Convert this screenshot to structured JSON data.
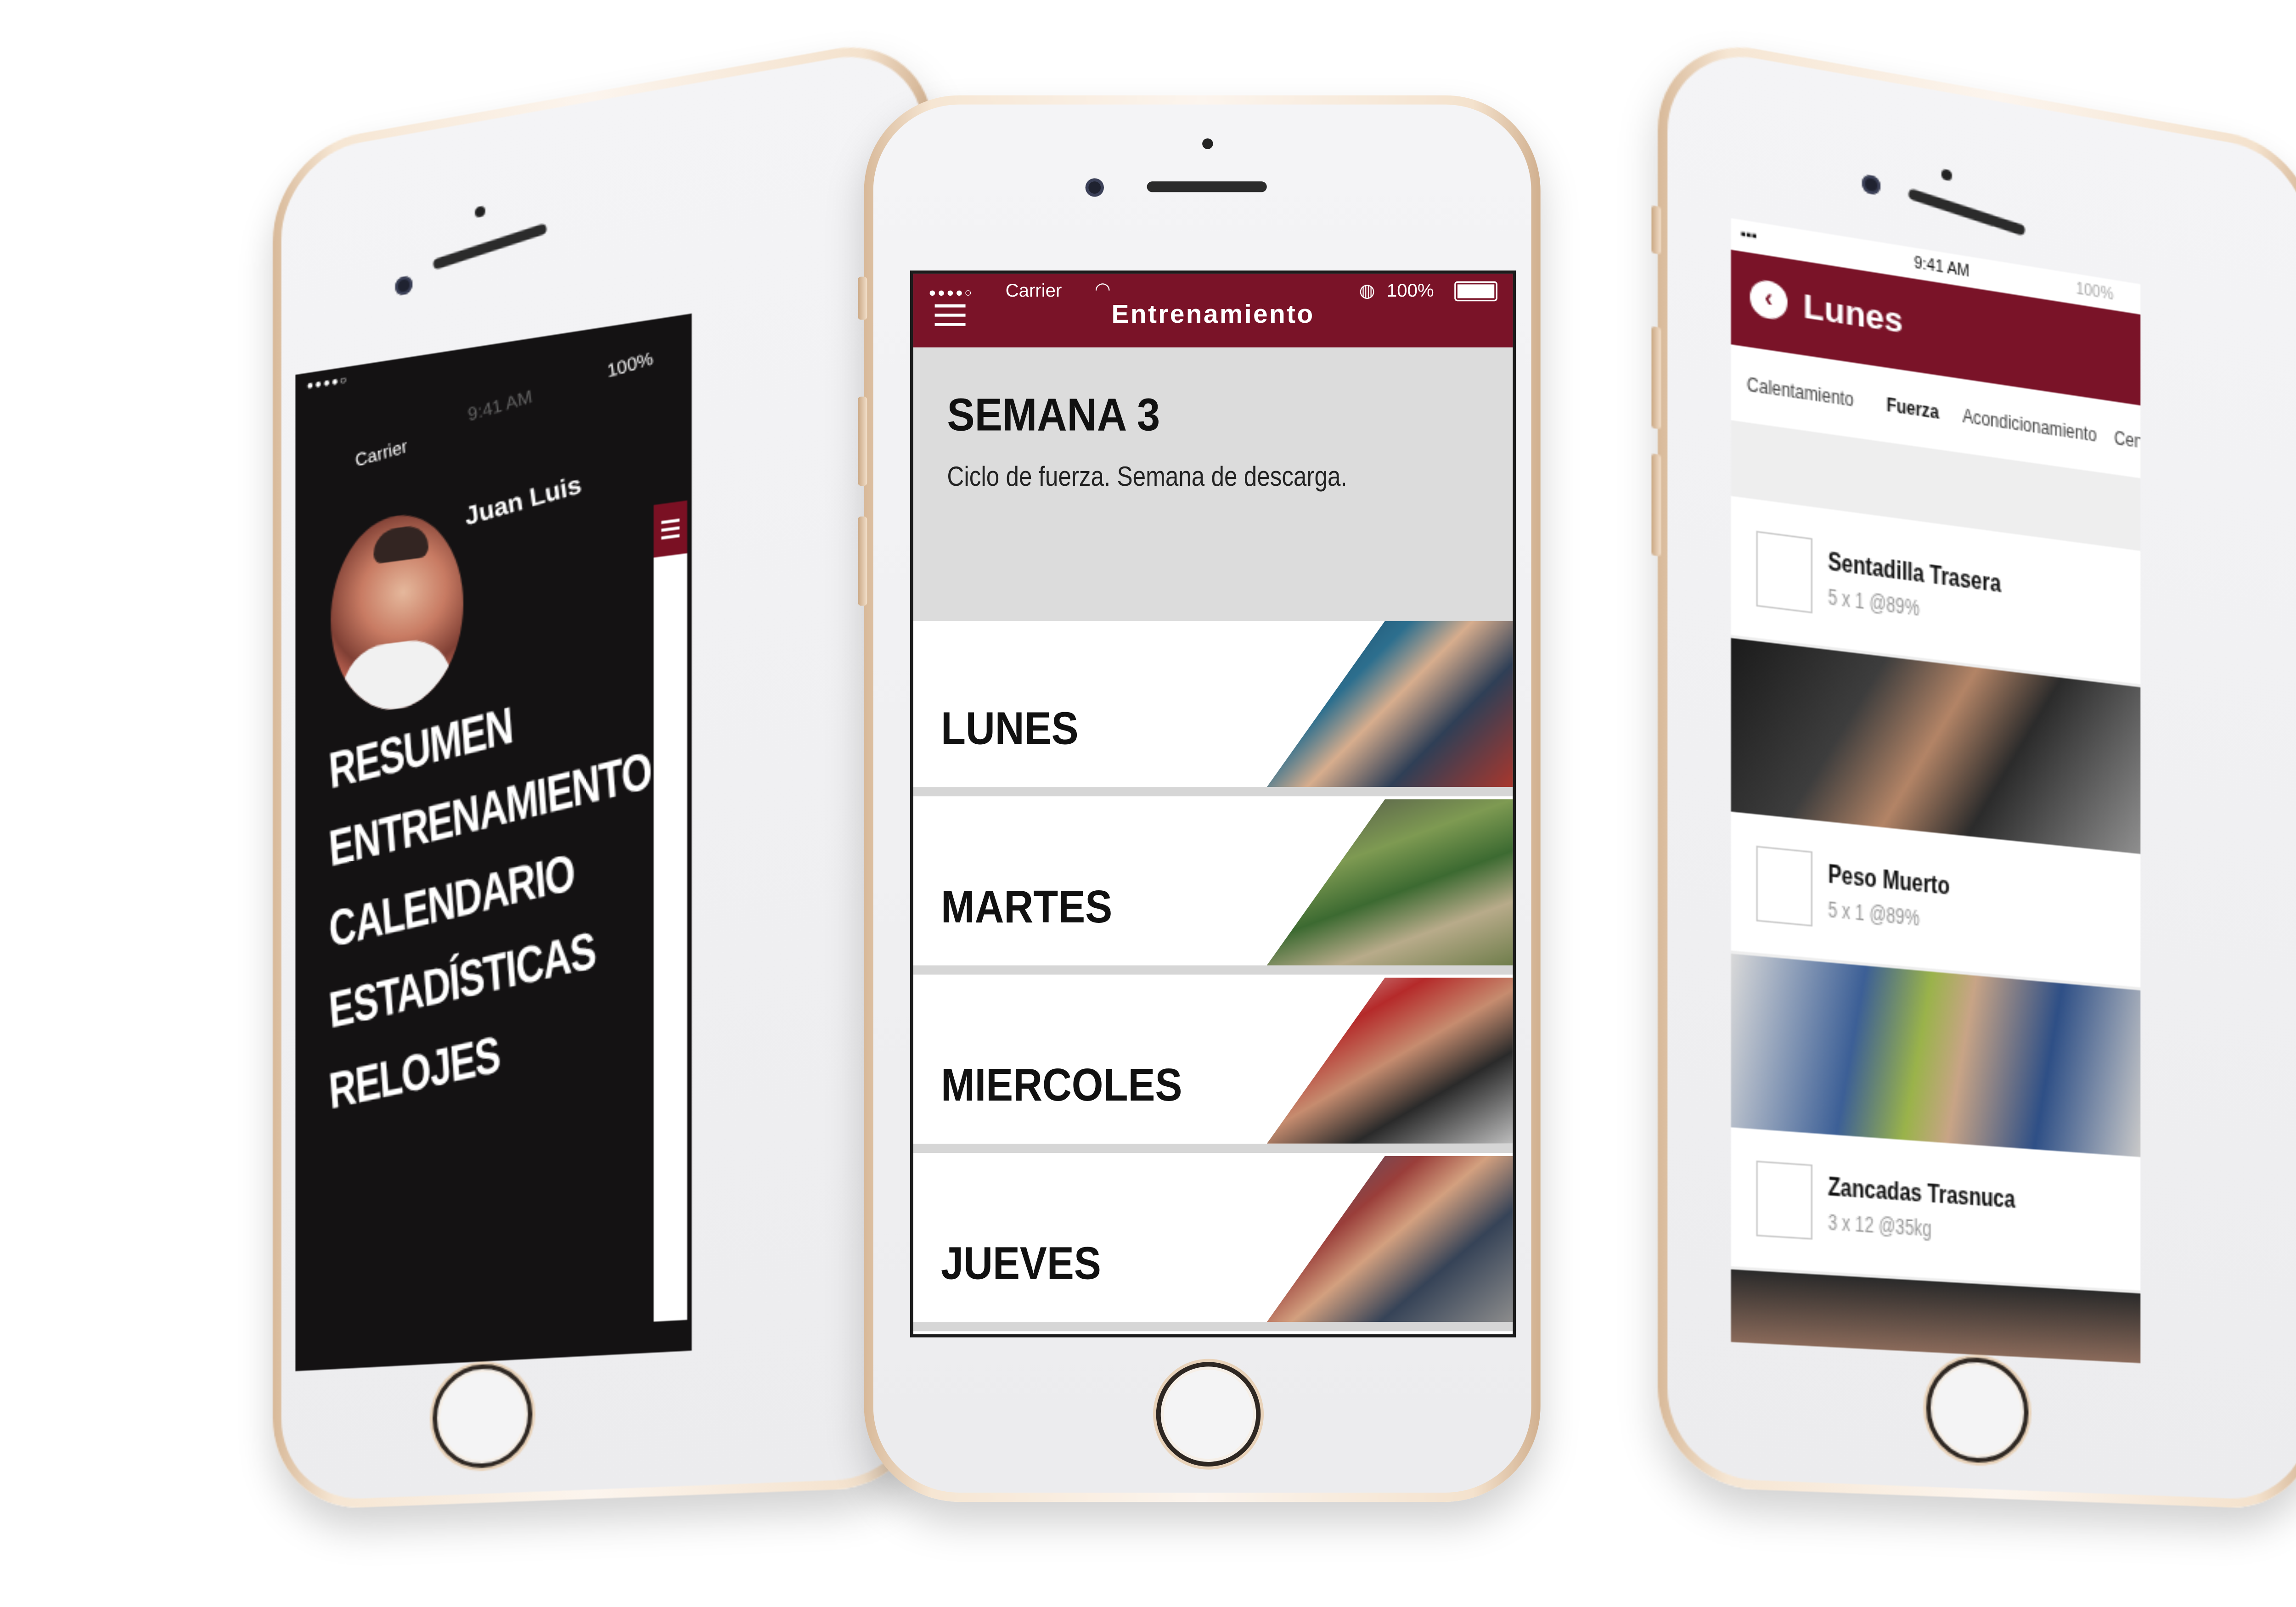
{
  "colors": {
    "brand": "#7a1328",
    "menu_bg": "#141213",
    "header_gray": "#dcdcdc"
  },
  "screen_menu": {
    "status": {
      "carrier": "Carrier",
      "time": "9:41 AM",
      "battery": "100%"
    },
    "profile_name": "Juan Luis",
    "menu": [
      "RESUMEN",
      "ENTRENAMIENTO",
      "CALENDARIO",
      "ESTADÍSTICAS",
      "RELOJES"
    ],
    "panel_icon": "menu-icon"
  },
  "screen_week": {
    "status": {
      "carrier": "Carrier",
      "battery": "100%"
    },
    "title": "Entrenamiento",
    "menu_icon": "hamburger-icon",
    "week_title": "SEMANA 3",
    "week_subtitle": "Ciclo de fuerza. Semana de descarga.",
    "days": [
      "LUNES",
      "MARTES",
      "MIERCOLES",
      "JUEVES"
    ]
  },
  "screen_day": {
    "status": {
      "time": "9:41 AM",
      "battery": "100%"
    },
    "back_icon": "back-chevron-icon",
    "title": "Lunes",
    "tabs": [
      "Calentamiento",
      "Fuerza",
      "Acondicionamiento",
      "Cen"
    ],
    "active_tab": "Fuerza",
    "exercises": [
      {
        "name": "Sentadilla Trasera",
        "detail": "5 x 1 @89%"
      },
      {
        "name": "Peso Muerto",
        "detail": "5 x 1 @89%"
      },
      {
        "name": "Zancadas Trasnuca",
        "detail": "3 x 12 @35kg"
      }
    ]
  }
}
